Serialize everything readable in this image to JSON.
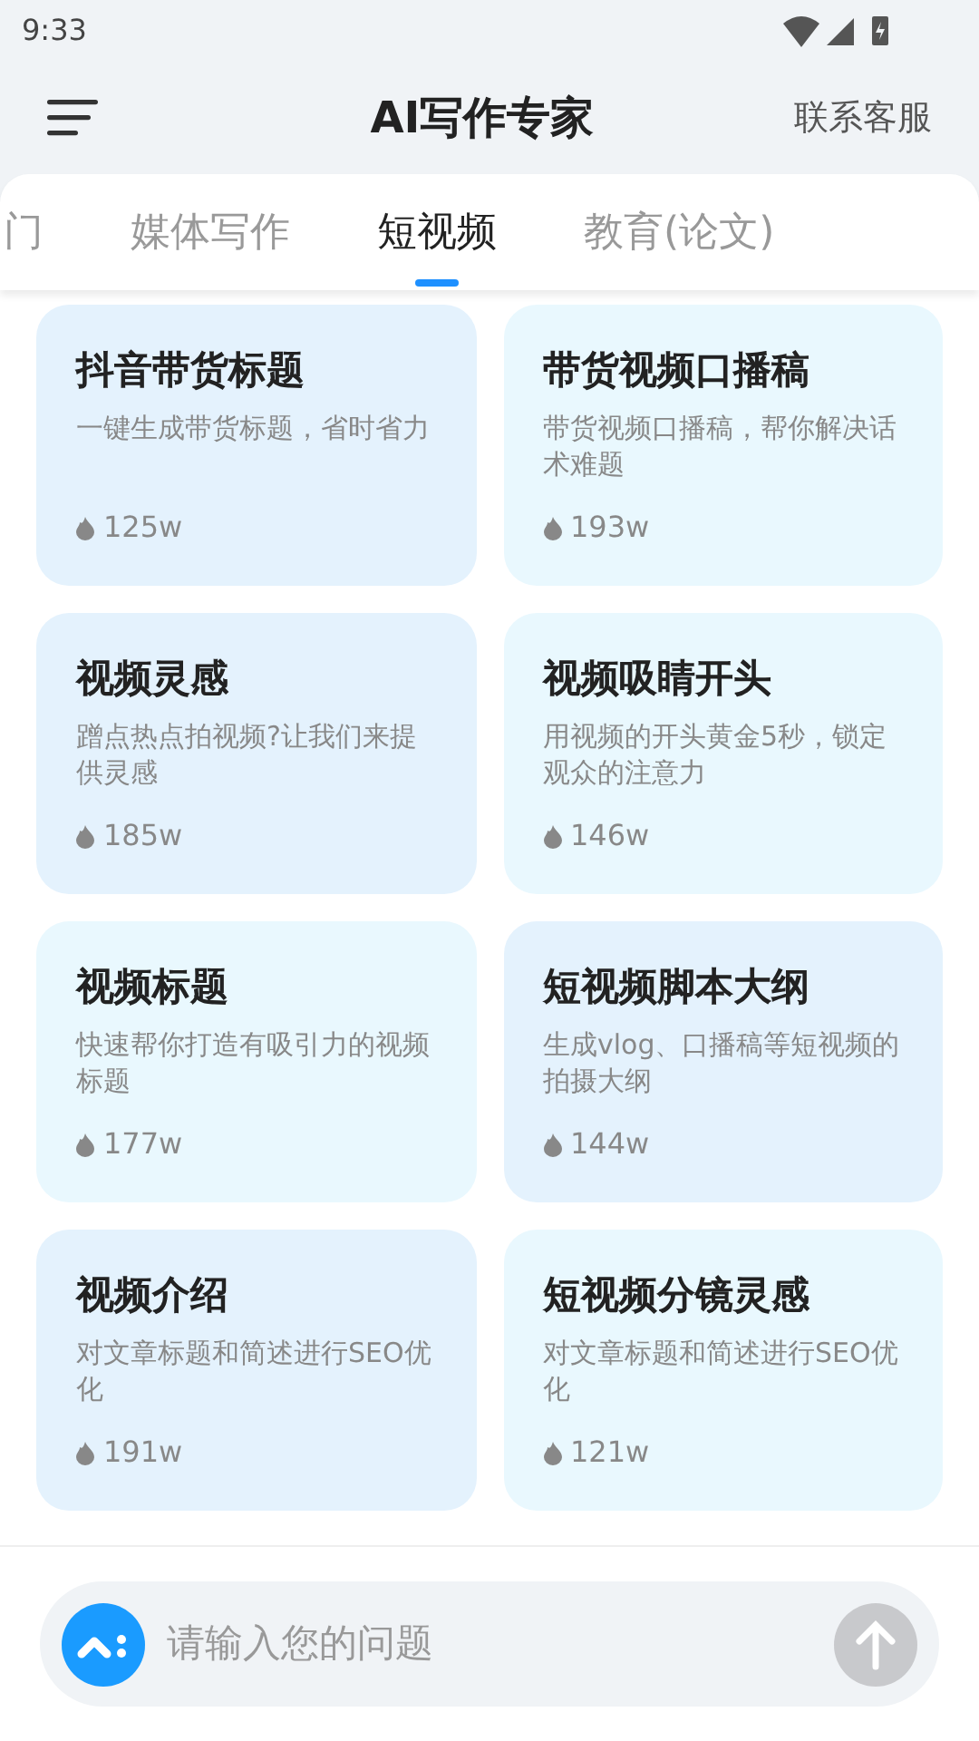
{
  "status_bar": {
    "time": "9:33"
  },
  "header": {
    "title": "AI写作专家",
    "action": "联系客服"
  },
  "tabs": [
    {
      "label": "门",
      "selected": false
    },
    {
      "label": "媒体写作",
      "selected": false
    },
    {
      "label": "短视频",
      "selected": true
    },
    {
      "label": "教育(论文)",
      "selected": false
    }
  ],
  "cards": [
    {
      "title": "抖音带货标题",
      "description": "一键生成带货标题，省时省力",
      "count": "125w",
      "color": "#e4f2fd"
    },
    {
      "title": "带货视频口播稿",
      "description": "带货视频口播稿，帮你解决话术难题",
      "count": "193w",
      "color": "#e9f8fe"
    },
    {
      "title": "视频灵感",
      "description": "蹭点热点拍视频?让我们来提供灵感",
      "count": "185w",
      "color": "#e4f2fd"
    },
    {
      "title": "视频吸睛开头",
      "description": "用视频的开头黄金5秒，锁定观众的注意力",
      "count": "146w",
      "color": "#e9f8fe"
    },
    {
      "title": "视频标题",
      "description": "快速帮你打造有吸引力的视频标题",
      "count": "177w",
      "color": "#e9f8fe"
    },
    {
      "title": "短视频脚本大纲",
      "description": "生成vlog、口播稿等短视频的拍摄大纲",
      "count": "144w",
      "color": "#e4f2fd"
    },
    {
      "title": "视频介绍",
      "description": "对文章标题和简述进行SEO优化",
      "count": "191w",
      "color": "#e4f2fd"
    },
    {
      "title": "短视频分镜灵感",
      "description": "对文章标题和简述进行SEO优化",
      "count": "121w",
      "color": "#e9f8fe"
    }
  ],
  "input": {
    "placeholder": "请输入您的问题"
  }
}
